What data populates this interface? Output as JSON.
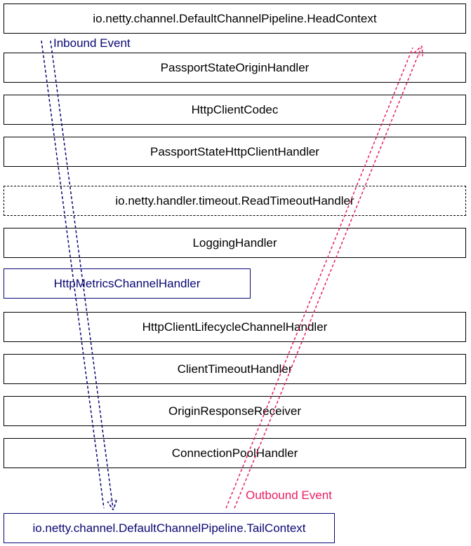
{
  "diagram": {
    "handlers": [
      "io.netty.channel.DefaultChannelPipeline.HeadContext",
      "PassportStateOriginHandler",
      "HttpClientCodec",
      "PassportStateHttpClientHandler",
      "io.netty.handler.timeout.ReadTimeoutHandler",
      "LoggingHandler",
      "HttpMetricsChannelHandler",
      "HttpClientLifecycleChannelHandler",
      "ClientTimeoutHandler",
      "OriginResponseReceiver",
      "ConnectionPoolHandler",
      "io.netty.channel.DefaultChannelPipeline.TailContext"
    ],
    "labels": {
      "inbound": "Inbound Event",
      "outbound": "Outbound Event"
    },
    "colors": {
      "inbound": "#0a0773",
      "outbound": "#e91e63",
      "border": "#000000"
    }
  }
}
